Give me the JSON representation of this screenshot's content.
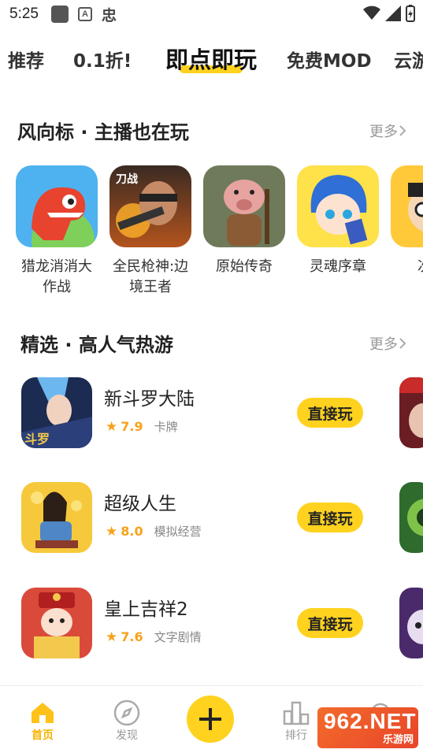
{
  "status_bar": {
    "time": "5:25",
    "notification_letter": "A",
    "app_icon_text": "忠"
  },
  "tabs": [
    "推荐",
    "0.1折!",
    "即点即玩",
    "免费MOD",
    "云游"
  ],
  "active_tab_index": 2,
  "section1": {
    "title": "风向标 · 主播也在玩",
    "more": "更多",
    "games": [
      {
        "name": "猎龙消消大作战",
        "icon": "dinosaur-icon"
      },
      {
        "name": "全民枪神:边境王者",
        "icon": "gunner-icon"
      },
      {
        "name": "原始传奇",
        "icon": "boar-warrior-icon"
      },
      {
        "name": "灵魂序章",
        "icon": "anime-hero-icon"
      },
      {
        "name": "次神",
        "icon": "cartoon-icon"
      }
    ]
  },
  "section2": {
    "title": "精选 · 高人气热游",
    "more": "更多",
    "games": [
      {
        "name": "新斗罗大陆",
        "score": "7.9",
        "category": "卡牌",
        "button": "直接玩"
      },
      {
        "name": "超级人生",
        "score": "8.0",
        "category": "模拟经营",
        "button": "直接玩"
      },
      {
        "name": "皇上吉祥2",
        "score": "7.6",
        "category": "文字剧情",
        "button": "直接玩"
      }
    ]
  },
  "bottom_nav": {
    "home": "首页",
    "discover": "发现",
    "ranking": "排行"
  },
  "watermark": {
    "big": "962.NET",
    "small": "乐游网"
  },
  "colors": {
    "accent": "#ffd21f",
    "star": "#f7a21b",
    "muted": "#999999"
  }
}
